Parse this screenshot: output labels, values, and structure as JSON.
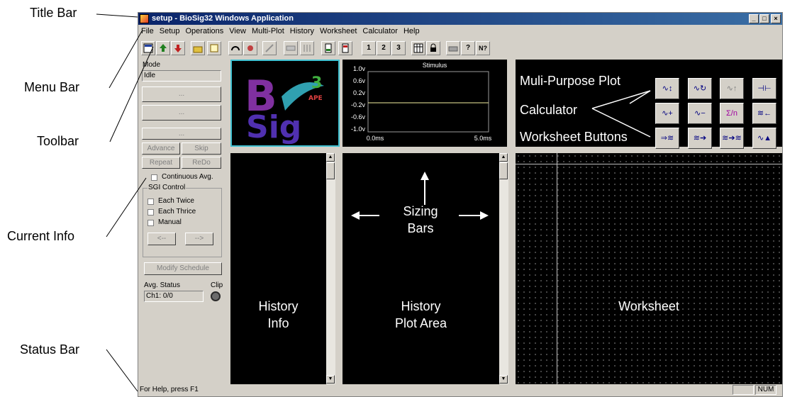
{
  "callouts": {
    "title_bar": "Title Bar",
    "menu_bar": "Menu Bar",
    "toolbar": "Toolbar",
    "current_info": "Current Info",
    "status_bar": "Status Bar",
    "multi_plot": "Muli-Purpose Plot",
    "calculator": "Calculator",
    "worksheet_buttons": "Worksheet Buttons",
    "sizing": "Sizing",
    "bars": "Bars"
  },
  "window": {
    "title": "setup - BioSig32 Windows Application",
    "controls": [
      "_",
      "□",
      "×"
    ]
  },
  "menu": [
    "File",
    "Setup",
    "Operations",
    "View",
    "Multi-Plot",
    "History",
    "Worksheet",
    "Calculator",
    "Help"
  ],
  "toolbar": {
    "numbered": [
      "1",
      "2",
      "3"
    ],
    "help_glyph": "?",
    "whatsthis_glyph": "N?"
  },
  "left": {
    "mode_label": "Mode",
    "mode_value": "Idle",
    "ellipsis": "...",
    "advance": "Advance",
    "skip": "Skip",
    "repeat": "Repeat",
    "redo": "ReDo",
    "continuous_avg": "Continuous Avg.",
    "sgi_control": "SGI Control",
    "each_twice": "Each Twice",
    "each_thrice": "Each Thrice",
    "manual": "Manual",
    "prev": "<--",
    "next": "-->",
    "modify_schedule": "Modify Schedule",
    "avg_status": "Avg. Status",
    "clip": "Clip",
    "ch1": "Ch1:  0/0"
  },
  "logo": {
    "b": "B",
    "sig": "Sig",
    "three": "3",
    "ape": "APE"
  },
  "stimulus": {
    "title": "Stimulus",
    "yticks": [
      "1.0v",
      "0.6v",
      "0.2v",
      "-0.2v",
      "-0.6v",
      "-1.0v"
    ],
    "xticks": [
      "0.0ms",
      "5.0ms"
    ]
  },
  "panes": {
    "history_info_1": "History",
    "history_info_2": "Info",
    "history_plot_1": "History",
    "history_plot_2": "Plot Area",
    "worksheet": "Worksheet"
  },
  "status": {
    "help_text": "For Help, press F1",
    "num": "NUM"
  },
  "colors": {
    "title_gradient_start": "#0a246a",
    "title_gradient_end": "#3a6ea5",
    "frame": "#d4d0c8",
    "pane": "#000000",
    "stimulus_line": "#f4f0a0",
    "logo_border": "#40c0d0"
  }
}
